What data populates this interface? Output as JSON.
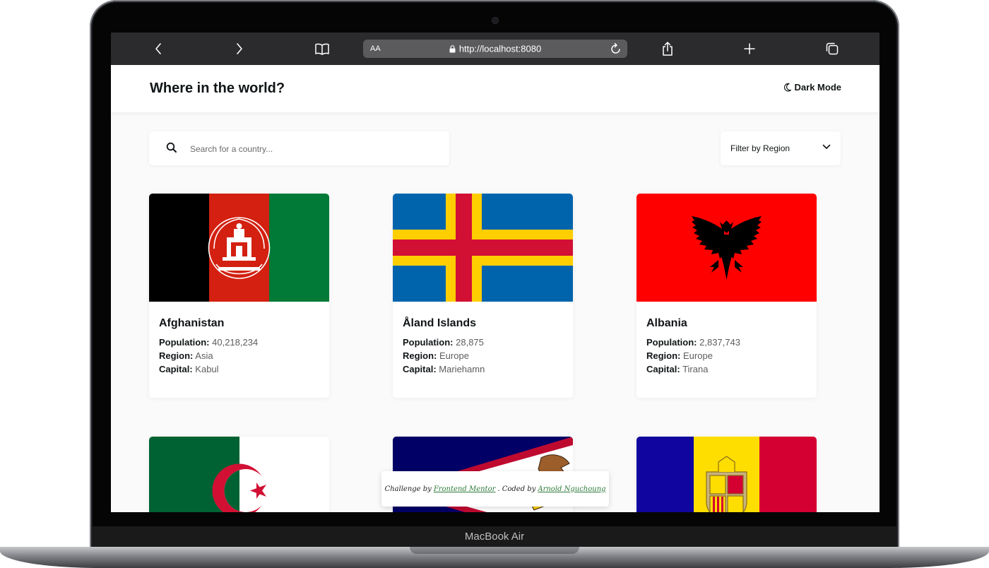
{
  "device": {
    "label": "MacBook Air"
  },
  "browser": {
    "url": "http://localhost:8080",
    "text_size_label": "AA"
  },
  "app": {
    "title": "Where in the world?",
    "dark_mode_label": "Dark Mode"
  },
  "search": {
    "placeholder": "Search for a country..."
  },
  "filter": {
    "label": "Filter by Region"
  },
  "field_labels": {
    "population": "Population:",
    "region": "Region:",
    "capital": "Capital:"
  },
  "countries": [
    {
      "name": "Afghanistan",
      "population": "40,218,234",
      "region": "Asia",
      "capital": "Kabul",
      "flag_icon": "afghanistan-flag"
    },
    {
      "name": "Åland Islands",
      "population": "28,875",
      "region": "Europe",
      "capital": "Mariehamn",
      "flag_icon": "aland-islands-flag"
    },
    {
      "name": "Albania",
      "population": "2,837,743",
      "region": "Europe",
      "capital": "Tirana",
      "flag_icon": "albania-flag"
    },
    {
      "name": "",
      "flag_icon": "algeria-flag"
    },
    {
      "name": "",
      "flag_icon": "american-samoa-flag"
    },
    {
      "name": "",
      "flag_icon": "andorra-flag"
    }
  ],
  "attribution": {
    "prefix": "Challenge by",
    "link1": "Frontend Mentor",
    "middle": ". Coded by",
    "link2": "Arnold Nguchoung"
  },
  "colors": {
    "page_bg": "#fafafa",
    "card_bg": "#ffffff",
    "text": "#111517",
    "browser_bar": "#2b2b2d",
    "attribution_link": "#2d7a3a"
  }
}
